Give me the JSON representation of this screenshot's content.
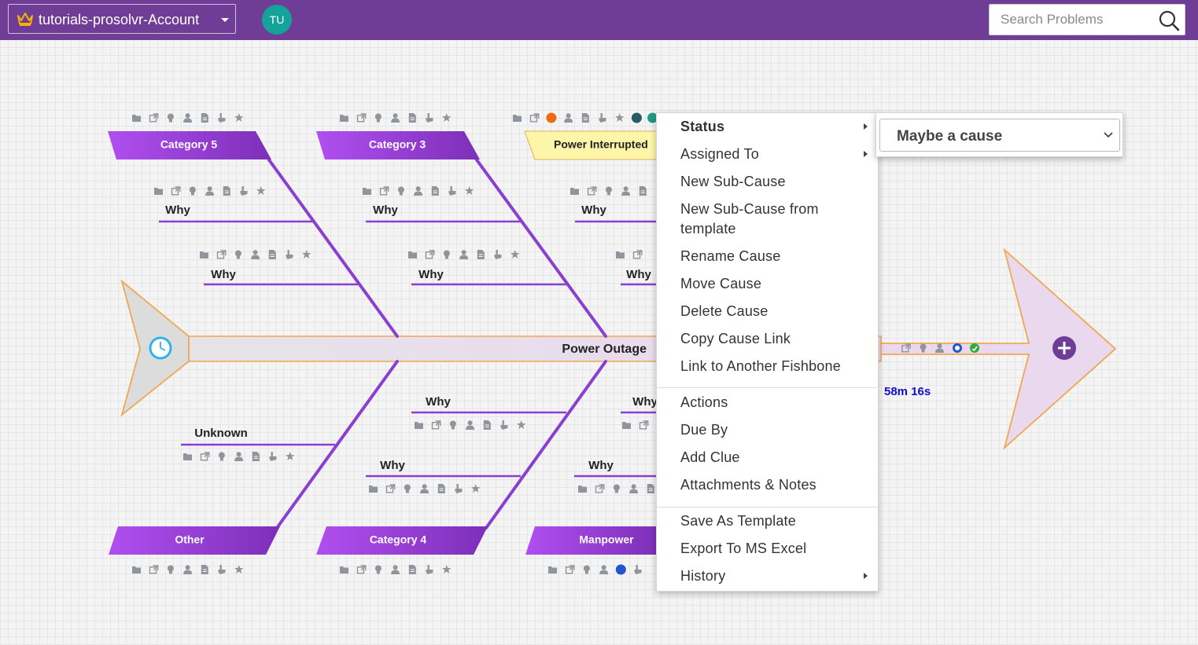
{
  "header": {
    "account_name": "tutorials-prosolvr-Account",
    "avatar_initials": "TU",
    "search_placeholder": "Search Problems"
  },
  "colors": {
    "header_bg": "#6f3c96",
    "bone_purple": "#8a3fd0",
    "category_gradient_start": "#b04ff0",
    "category_gradient_end": "#7d2fb8",
    "selected_category_bg": "#fdf5a8",
    "avatar_bg": "#14a39a",
    "timer_blue": "#1010c8"
  },
  "fishbone": {
    "problem": "Power Outage",
    "timer": "58m 16s",
    "categories": {
      "top": [
        "Category 5",
        "Category 3",
        "Power Interrupted"
      ],
      "bottom": [
        "Other",
        "Category 4",
        "Manpower"
      ]
    },
    "sub_causes": {
      "cat5_1": "Why",
      "cat5_2": "Why",
      "cat3_1": "Why",
      "cat3_2": "Why",
      "pi_1": "Why",
      "pi_2": "Why",
      "other_1": "Unknown",
      "cat4_1": "Why",
      "cat4_2": "Why",
      "man_1": "Why",
      "man_2": "Why"
    },
    "icon_set": [
      "folder-icon",
      "external-link-icon",
      "lightbulb-icon",
      "person-icon",
      "document-icon",
      "hand-icon",
      "star-icon"
    ]
  },
  "context_menu": {
    "status": "Status",
    "assigned_to": "Assigned To",
    "new_sub_cause": "New Sub-Cause",
    "new_sub_cause_template_1": "New Sub-Cause from",
    "new_sub_cause_template_2": "template",
    "rename_cause": "Rename Cause",
    "move_cause": "Move Cause",
    "delete_cause": "Delete Cause",
    "copy_cause_link": "Copy Cause Link",
    "link_fishbone": "Link to Another Fishbone",
    "actions": "Actions",
    "due_by": "Due By",
    "add_clue": "Add Clue",
    "attachments_notes": "Attachments & Notes",
    "save_as_template": "Save As Template",
    "export_excel": "Export To MS Excel",
    "history": "History"
  },
  "status_submenu": {
    "selected": "Maybe a cause"
  }
}
